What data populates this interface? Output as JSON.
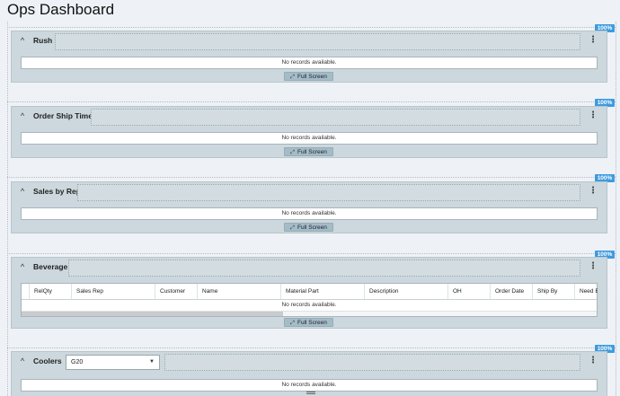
{
  "page": {
    "title": "Ops Dashboard"
  },
  "badges": {
    "zoom": "100%"
  },
  "common": {
    "no_records": "No records available.",
    "full_screen_label": "Full Screen",
    "full_screen_icon": "expand-arrows-icon",
    "kebab": "⋮",
    "collapse": "^"
  },
  "panels": [
    {
      "title": "Rush"
    },
    {
      "title": "Order Ship Time"
    },
    {
      "title": "Sales by Rep"
    },
    {
      "title": "Beverage",
      "columns": [
        "RelQty",
        "Sales Rep",
        "Customer",
        "Name",
        "Material Part",
        "Description",
        "OH",
        "Order Date",
        "Ship By",
        "Need By"
      ]
    },
    {
      "title": "Coolers",
      "filter": {
        "selected": "G20",
        "caret": "▼"
      }
    }
  ]
}
